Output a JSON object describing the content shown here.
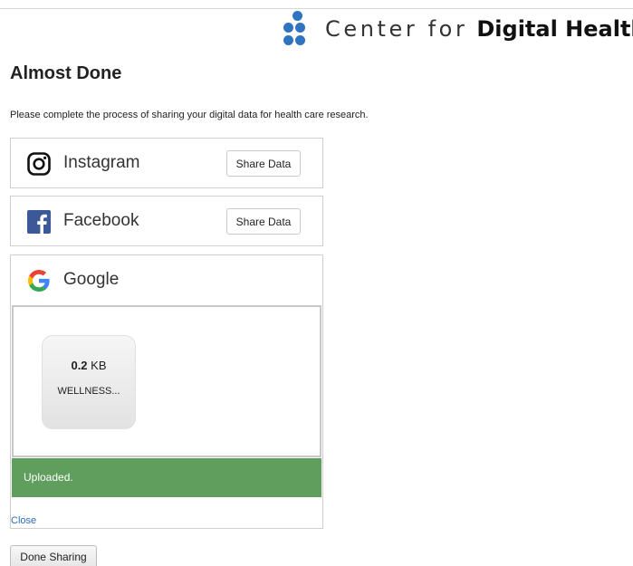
{
  "header": {
    "brand_light": "Center for",
    "brand_bold": "Digital Health",
    "brand_color": "#2f74c0"
  },
  "page": {
    "title": "Almost Done",
    "intro": "Please complete the process of sharing your digital data for health care research."
  },
  "services": {
    "instagram": {
      "name": "Instagram",
      "button_label": "Share Data",
      "icon": "instagram-icon"
    },
    "facebook": {
      "name": "Facebook",
      "button_label": "Share Data",
      "icon": "facebook-icon"
    },
    "google": {
      "name": "Google",
      "icon": "google-icon",
      "file": {
        "size_value": "0.2",
        "size_unit": "KB",
        "name": "WELLNESS..."
      },
      "status": "Uploaded.",
      "status_color": "#5f9e5c",
      "close_label": "Close"
    }
  },
  "footer": {
    "done_label": "Done Sharing"
  }
}
